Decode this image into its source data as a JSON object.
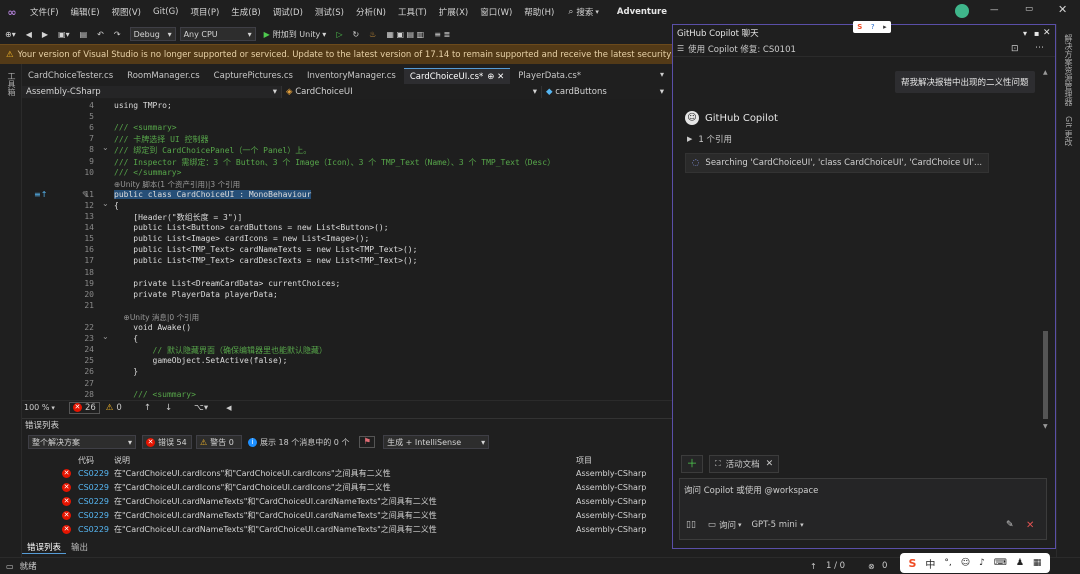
{
  "menubar": {
    "items": [
      "文件(F)",
      "编辑(E)",
      "视图(V)",
      "Git(G)",
      "项目(P)",
      "生成(B)",
      "调试(D)",
      "测试(S)",
      "分析(N)",
      "工具(T)",
      "扩展(X)",
      "窗口(W)",
      "帮助(H)"
    ],
    "search_label": "搜索",
    "solution_name": "Adventure"
  },
  "toolbar": {
    "config": "Debug",
    "platform": "Any CPU",
    "attach_label": "附加到 Unity"
  },
  "warning": {
    "text": "Your version of Visual Studio is no longer supported or serviced. Update to the latest version of 17.14 to remain supported and receive the latest security and q"
  },
  "tabs": [
    {
      "label": "CardChoiceTester.cs",
      "active": false
    },
    {
      "label": "RoomManager.cs",
      "active": false
    },
    {
      "label": "CapturePictures.cs",
      "active": false
    },
    {
      "label": "InventoryManager.cs",
      "active": false
    },
    {
      "label": "CardChoiceUI.cs*",
      "active": true
    },
    {
      "label": "PlayerData.cs*",
      "active": false
    }
  ],
  "navbar": {
    "project": "Assembly-CSharp",
    "class": "CardChoiceUI",
    "member": "cardButtons"
  },
  "code_lines": [
    {
      "n": "4",
      "t": "using TMPro;"
    },
    {
      "n": "5",
      "t": ""
    },
    {
      "n": "6",
      "t": "/// <summary>"
    },
    {
      "n": "7",
      "t": "/// 卡牌选择 UI 控制器"
    },
    {
      "n": "8",
      "t": "/// 绑定到 CardChoicePanel（一个 Panel）上。"
    },
    {
      "n": "9",
      "t": "/// Inspector 需绑定：3 个 Button、3 个 Image（Icon）、3 个 TMP_Text（Name）、3 个 TMP_Text（Desc）"
    },
    {
      "n": "10",
      "t": "/// </summary>"
    },
    {
      "n": "",
      "t": "⊕Unity 脚本(1 个资产引用)|3 个引用"
    },
    {
      "n": "11",
      "t": "public class CardChoiceUI : MonoBehaviour"
    },
    {
      "n": "12",
      "t": "{"
    },
    {
      "n": "13",
      "t": "    [Header(\"数组长度 = 3\")]"
    },
    {
      "n": "14",
      "t": "    public List<Button> cardButtons = new List<Button>();"
    },
    {
      "n": "15",
      "t": "    public List<Image> cardIcons = new List<Image>();"
    },
    {
      "n": "16",
      "t": "    public List<TMP_Text> cardNameTexts = new List<TMP_Text>();"
    },
    {
      "n": "17",
      "t": "    public List<TMP_Text> cardDescTexts = new List<TMP_Text>();"
    },
    {
      "n": "18",
      "t": ""
    },
    {
      "n": "19",
      "t": "    private List<DreamCardData> currentChoices;"
    },
    {
      "n": "20",
      "t": "    private PlayerData playerData;"
    },
    {
      "n": "21",
      "t": ""
    },
    {
      "n": "",
      "t": "    ⊕Unity 消息|0 个引用"
    },
    {
      "n": "22",
      "t": "    void Awake()"
    },
    {
      "n": "23",
      "t": "    {"
    },
    {
      "n": "24",
      "t": "        // 默认隐藏界面（确保编辑器里也能默认隐藏）"
    },
    {
      "n": "25",
      "t": "        gameObject.SetActive(false);"
    },
    {
      "n": "26",
      "t": "    }"
    },
    {
      "n": "27",
      "t": ""
    },
    {
      "n": "28",
      "t": "    /// <summary>"
    }
  ],
  "editor_status": {
    "zoom": "100 %",
    "errors": "26",
    "warnings": "0"
  },
  "errlist": {
    "title": "错误列表",
    "scope": "整个解决方案",
    "errors_label": "错误 54",
    "warnings_label": "警告 0",
    "messages_label": "展示 18 个消息中的 0 个",
    "build_filter": "生成 + IntelliSense",
    "columns": {
      "code": "代码",
      "desc": "说明",
      "project": "项目"
    },
    "rows": [
      {
        "code": "CS0229",
        "desc": "在\"CardChoiceUI.cardIcons\"和\"CardChoiceUI.cardIcons\"之间具有二义性",
        "project": "Assembly-CSharp"
      },
      {
        "code": "CS0229",
        "desc": "在\"CardChoiceUI.cardIcons\"和\"CardChoiceUI.cardIcons\"之间具有二义性",
        "project": "Assembly-CSharp"
      },
      {
        "code": "CS0229",
        "desc": "在\"CardChoiceUI.cardNameTexts\"和\"CardChoiceUI.cardNameTexts\"之间具有二义性",
        "project": "Assembly-CSharp"
      },
      {
        "code": "CS0229",
        "desc": "在\"CardChoiceUI.cardNameTexts\"和\"CardChoiceUI.cardNameTexts\"之间具有二义性",
        "project": "Assembly-CSharp"
      },
      {
        "code": "CS0229",
        "desc": "在\"CardChoiceUI.cardNameTexts\"和\"CardChoiceUI.cardNameTexts\"之间具有二义性",
        "project": "Assembly-CSharp"
      }
    ],
    "bottom_tabs": [
      "错误列表",
      "输出"
    ]
  },
  "status": {
    "ready": "就绪",
    "position": "1 / 0",
    "errors": "0"
  },
  "copilot": {
    "title": "GitHub Copilot 聊天",
    "fix_label": "使用 Copilot 修复: CS0101",
    "user_message": "帮我解决报错中出现的二义性问题",
    "assistant_name": "GitHub Copilot",
    "refs_label": "1 个引用",
    "search_status": "Searching 'CardChoiceUI', 'class CardChoiceUI', 'CardChoice UI'...",
    "active_doc_label": "活动文档",
    "input_placeholder": "询问 Copilot 或使用 @workspace",
    "mode": "询问",
    "model": "GPT-5 mini"
  },
  "ime": {
    "lang": "中"
  },
  "colors": {
    "accent": "#569cd6",
    "warning_bg": "#533a17",
    "error_red": "#e51400",
    "copilot_border": "#5a4fa8"
  }
}
